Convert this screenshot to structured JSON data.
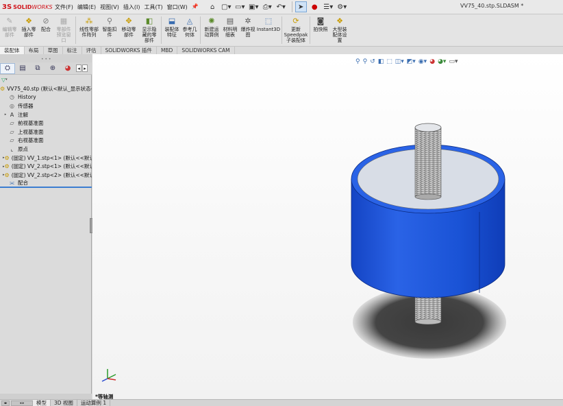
{
  "app": {
    "logo_mark": "3S",
    "brand_solid": "SOLID",
    "brand_works": "WORKS",
    "doc_title": "VV75_40.stp.SLDASM *"
  },
  "menu": {
    "items": [
      "文件(F)",
      "编辑(E)",
      "视图(V)",
      "插入(I)",
      "工具(T)",
      "窗口(W)"
    ],
    "pin_icon": "pin-icon"
  },
  "quick_access": {
    "icons": [
      "home-icon",
      "new-document-icon",
      "open-folder-icon",
      "save-icon",
      "print-icon",
      "undo-icon",
      "select-pointer-icon",
      "rebuild-icon",
      "file-properties-icon",
      "options-gear-icon"
    ]
  },
  "command_manager": {
    "items": [
      {
        "label": "编辑零\n部件",
        "icon": "edit-component-icon",
        "disabled": true
      },
      {
        "label": "插入零\n部件",
        "icon": "insert-component-icon",
        "disabled": false
      },
      {
        "label": "配合",
        "icon": "mate-icon",
        "disabled": false
      },
      {
        "label": "零部件\n预览窗\n口",
        "icon": "component-preview-icon",
        "disabled": true
      },
      {
        "label": "线性零部\n件阵列",
        "icon": "linear-pattern-icon",
        "disabled": false
      },
      {
        "label": "智能扣\n件",
        "icon": "smart-fasteners-icon",
        "disabled": false
      },
      {
        "label": "移动零\n部件",
        "icon": "move-component-icon",
        "disabled": false
      },
      {
        "label": "显示隐\n藏的零\n部件",
        "icon": "show-hidden-icon",
        "disabled": false
      },
      {
        "label": "装配体\n特征",
        "icon": "assembly-features-icon",
        "disabled": false
      },
      {
        "label": "参考几\n何体",
        "icon": "reference-geometry-icon",
        "disabled": false
      },
      {
        "label": "新建运\n动算例",
        "icon": "new-motion-study-icon",
        "disabled": false
      },
      {
        "label": "材料明\n细表",
        "icon": "bom-icon",
        "disabled": false
      },
      {
        "label": "爆炸视\n图",
        "icon": "exploded-view-icon",
        "disabled": false
      },
      {
        "label": "Instant3D",
        "icon": "instant3d-icon",
        "disabled": false
      },
      {
        "label": "更新\nSpeedpak\n子装配体",
        "icon": "speedpak-icon",
        "disabled": false
      },
      {
        "label": "拍快照",
        "icon": "snapshot-icon",
        "disabled": false
      },
      {
        "label": "大型装\n配体设\n置",
        "icon": "large-assembly-icon",
        "disabled": false
      }
    ]
  },
  "tabs": {
    "items": [
      "装配体",
      "布局",
      "草图",
      "标注",
      "评估",
      "SOLIDWORKS 插件",
      "MBD",
      "SOLIDWORKS CAM"
    ],
    "active_index": 0
  },
  "panel_tabs": {
    "icons": [
      "feature-manager-icon",
      "property-manager-icon",
      "configuration-manager-icon",
      "dimxpert-icon",
      "display-manager-icon"
    ],
    "nav_left": "◂",
    "nav_right": "▸"
  },
  "tree": {
    "filter_icon": "filter-icon",
    "nodes": [
      {
        "label": "VV75_40.stp  (默认<默认_显示状态-1",
        "icon": "assembly-icon",
        "level": 0,
        "expand": ""
      },
      {
        "label": "History",
        "icon": "history-icon",
        "level": 1,
        "expand": ""
      },
      {
        "label": "传感器",
        "icon": "sensor-icon",
        "level": 1,
        "expand": ""
      },
      {
        "label": "注解",
        "icon": "annotation-icon",
        "level": 1,
        "expand": "▸"
      },
      {
        "label": "前视基准面",
        "icon": "plane-icon",
        "level": 1,
        "expand": ""
      },
      {
        "label": "上视基准面",
        "icon": "plane-icon",
        "level": 1,
        "expand": ""
      },
      {
        "label": "右视基准面",
        "icon": "plane-icon",
        "level": 1,
        "expand": ""
      },
      {
        "label": "原点",
        "icon": "origin-icon",
        "level": 1,
        "expand": ""
      },
      {
        "label": "(固定) VV_1.stp<1> (默认<<默认",
        "icon": "part-icon",
        "level": 1,
        "expand": "▸"
      },
      {
        "label": "(固定) VV_2.stp<1> (默认<<默认",
        "icon": "part-icon",
        "level": 1,
        "expand": "▸"
      },
      {
        "label": "(固定) VV_2.stp<2> (默认<<默认",
        "icon": "part-icon",
        "level": 1,
        "expand": "▸"
      },
      {
        "label": "配合",
        "icon": "mates-folder-icon",
        "level": 1,
        "expand": ""
      }
    ]
  },
  "heads_up": {
    "icons": [
      "zoom-to-fit-icon",
      "zoom-area-icon",
      "previous-view-icon",
      "section-view-icon",
      "dynamic-annotation-icon",
      "view-orientation-icon",
      "display-style-icon",
      "hide-show-icon",
      "edit-appearance-icon",
      "scene-icon",
      "view-settings-icon",
      "display-pane-icon"
    ]
  },
  "graphics": {
    "view_name": "*等轴测",
    "triad_icon": "axis-triad-icon",
    "colors": {
      "cylinder_side": "#1a53d6",
      "cylinder_top_rim": "#2a63e6",
      "cylinder_top_face": "#d8dde6",
      "bolt": "#c8c8c8",
      "shadow": "#3a3a3a"
    }
  },
  "bottom_tabs": {
    "items": [
      "模型",
      "3D 视图",
      "运动算例 1"
    ],
    "active_index": 0
  }
}
